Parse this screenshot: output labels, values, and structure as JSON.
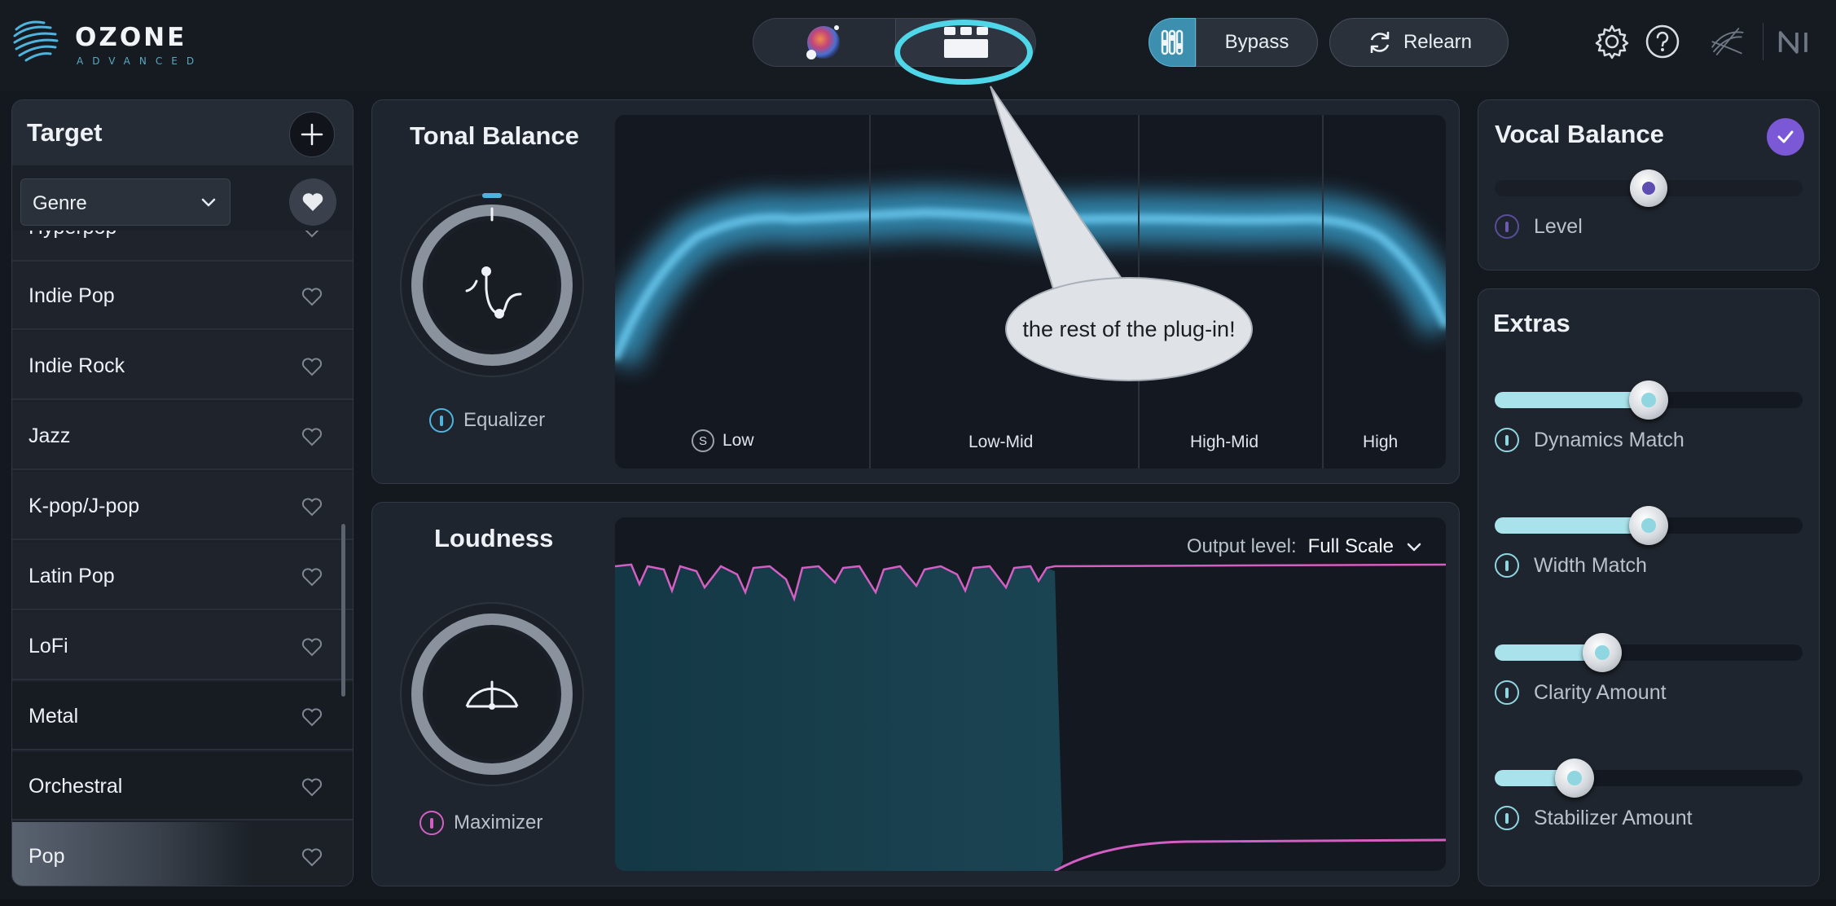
{
  "app": {
    "name": "OZONE",
    "edition": "ADVANCED"
  },
  "header": {
    "bypass_label": "Bypass",
    "relearn_label": "Relearn"
  },
  "target": {
    "title": "Target",
    "selector_value": "Genre",
    "items": [
      {
        "label": "Hyperpop"
      },
      {
        "label": "Indie Pop"
      },
      {
        "label": "Indie Rock"
      },
      {
        "label": "Jazz"
      },
      {
        "label": "K-pop/J-pop"
      },
      {
        "label": "Latin Pop"
      },
      {
        "label": "LoFi"
      },
      {
        "label": "Metal"
      },
      {
        "label": "Orchestral"
      },
      {
        "label": "Pop"
      }
    ],
    "selected": "Pop"
  },
  "tonal_balance": {
    "title": "Tonal Balance",
    "module_label": "Equalizer",
    "solo_label": "S",
    "bands": [
      "Low",
      "Low-Mid",
      "High-Mid",
      "High"
    ]
  },
  "loudness": {
    "title": "Loudness",
    "module_label": "Maximizer",
    "output_label": "Output level:",
    "output_value": "Full Scale"
  },
  "vocal_balance": {
    "title": "Vocal Balance",
    "level_label": "Level",
    "level_value": 0.5,
    "enabled": true
  },
  "extras": {
    "title": "Extras",
    "sliders": [
      {
        "label": "Dynamics Match",
        "value": 0.5
      },
      {
        "label": "Width Match",
        "value": 0.5
      },
      {
        "label": "Clarity Amount",
        "value": 0.35
      },
      {
        "label": "Stabilizer Amount",
        "value": 0.26
      }
    ]
  },
  "annotation": {
    "callout_text": "the rest of the plug-in!"
  },
  "colors": {
    "accent_blue": "#4fb4dd",
    "accent_cyan": "#4fd6e8",
    "accent_purple": "#7a58d6",
    "accent_pink": "#d45fc4",
    "panel": "#1f252e",
    "background": "#14181f"
  },
  "icons": {
    "view_left": "assistant-orb-icon",
    "view_right": "modules-grid-icon",
    "settings": "gear-icon",
    "help": "help-icon",
    "brand": "izotope-icon",
    "ni": "native-instruments-icon"
  }
}
